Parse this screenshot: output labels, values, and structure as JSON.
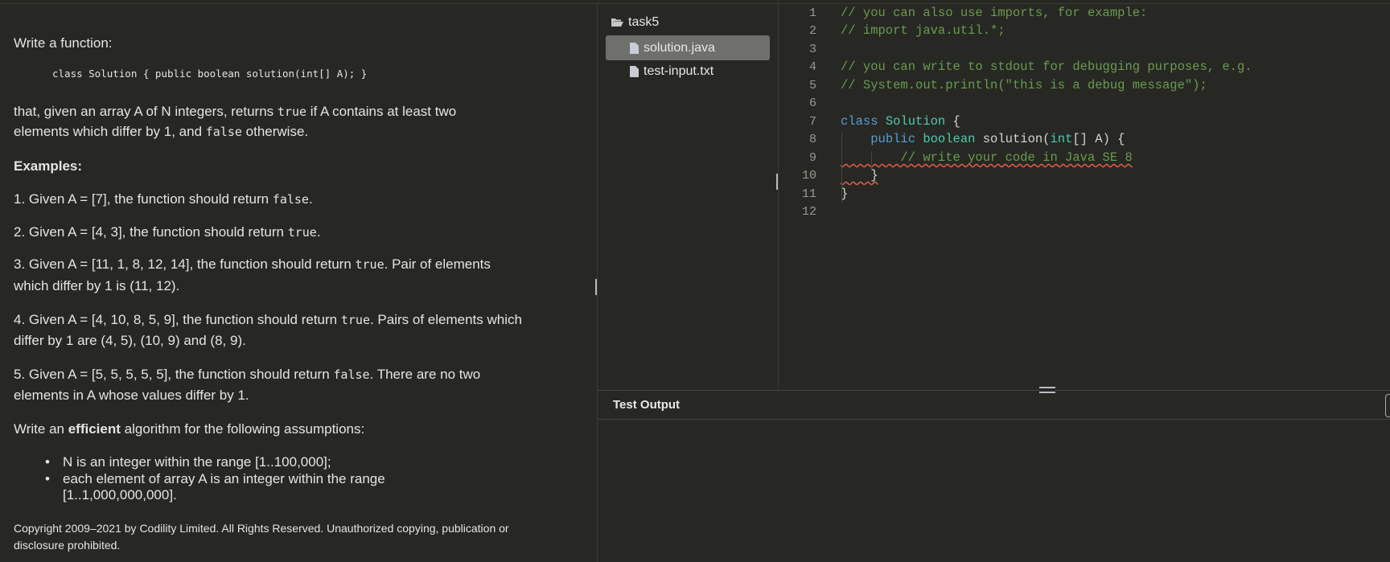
{
  "problem": {
    "intro": "Write a function:",
    "signature": "class Solution { public boolean solution(int[] A); }",
    "desc_line1_a": "that, given an array A of N integers, returns ",
    "desc_line1_code": "true",
    "desc_line1_b": " if A contains at least two",
    "desc_line2_a": "elements which differ by 1, and ",
    "desc_line2_code": "false",
    "desc_line2_b": " otherwise.",
    "examples_heading": "Examples:",
    "examples": [
      {
        "a": "1. Given A = [7], the function should return ",
        "code": "false",
        "b": ".",
        "c": ""
      },
      {
        "a": "2. Given A = [4, 3], the function should return ",
        "code": "true",
        "b": ".",
        "c": ""
      },
      {
        "a": "3. Given A = [11, 1, 8, 12, 14], the function should return ",
        "code": "true",
        "b": ". Pair of elements",
        "c": "which differ by 1 is (11, 12)."
      },
      {
        "a": "4. Given A = [4, 10, 8, 5, 9], the function should return ",
        "code": "true",
        "b": ". Pairs of elements which",
        "c": "differ by 1 are (4, 5), (10, 9) and (8, 9)."
      },
      {
        "a": "5. Given A = [5, 5, 5, 5, 5], the function should return ",
        "code": "false",
        "b": ". There are no two",
        "c": "elements in A whose values differ by 1."
      }
    ],
    "efficient_a": "Write an ",
    "efficient_bold": "efficient",
    "efficient_b": " algorithm for the following assumptions:",
    "assumptions": [
      "N is an integer within the range [1..100,000];",
      "each element of array A is an integer within the range",
      "[1..1,000,000,000]."
    ],
    "bullet": "•",
    "copyright_1": "Copyright 2009–2021 by Codility Limited. All Rights Reserved. Unauthorized copying, publication or",
    "copyright_2": "disclosure prohibited."
  },
  "file_tree": {
    "folder": "task5",
    "files": [
      {
        "name": "solution.java",
        "selected": true
      },
      {
        "name": "test-input.txt",
        "selected": false
      }
    ]
  },
  "editor": {
    "line_numbers": [
      "1",
      "2",
      "3",
      "4",
      "5",
      "6",
      "7",
      "8",
      "9",
      "10",
      "11",
      "12"
    ],
    "lines": {
      "l1": "// you can also use imports, for example:",
      "l2": "// import java.util.*;",
      "l4": "// you can write to stdout for debugging purposes, e.g.",
      "l5": "// System.out.println(\"this is a debug message\");",
      "l7_kw": "class",
      "l7_name": " Solution ",
      "l7_brace": "{",
      "l8_indent": "    ",
      "l8_kw": "public",
      "l8_type": " boolean",
      "l8_fn": " solution(",
      "l8_int": "int",
      "l8_rest": "[] A) {",
      "l9": "        // write your code in Java SE 8",
      "l10": "    }",
      "l11": "}"
    }
  },
  "output": {
    "title": "Test Output"
  },
  "colors": {
    "background": "#272823",
    "comment": "#6a9a4f",
    "keyword": "#569cd6",
    "type": "#4ec9b0",
    "error": "#e05a4a"
  }
}
